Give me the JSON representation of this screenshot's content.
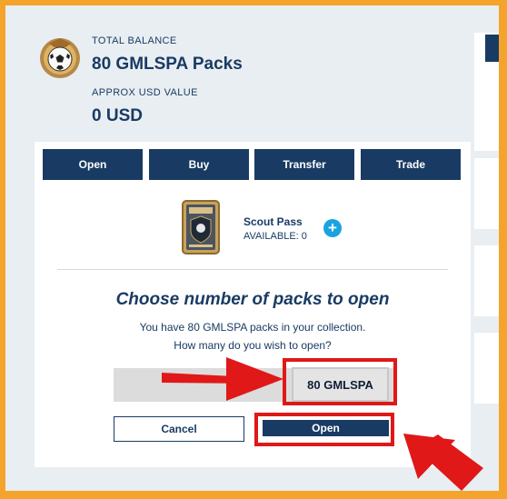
{
  "balance": {
    "total_label": "TOTAL BALANCE",
    "total_value": "80 GMLSPA Packs",
    "usd_label": "APPROX USD VALUE",
    "usd_value": "0 USD"
  },
  "actions": [
    "Open",
    "Buy",
    "Transfer",
    "Trade"
  ],
  "pack": {
    "name": "Scout Pass",
    "available": "AVAILABLE: 0",
    "add_symbol": "+"
  },
  "dialog": {
    "heading": "Choose number of packs to open",
    "line1": "You have 80 GMLSPA packs in your collection.",
    "line2": "How many do you wish to open?",
    "quantity_number": "80",
    "quantity_unit": "GMLSPA",
    "cancel_label": "Cancel",
    "open_label": "Open"
  },
  "colors": {
    "accent": "#193b63",
    "info": "#1aa3e0",
    "highlight": "#e01818",
    "border": "#f4a42d"
  }
}
